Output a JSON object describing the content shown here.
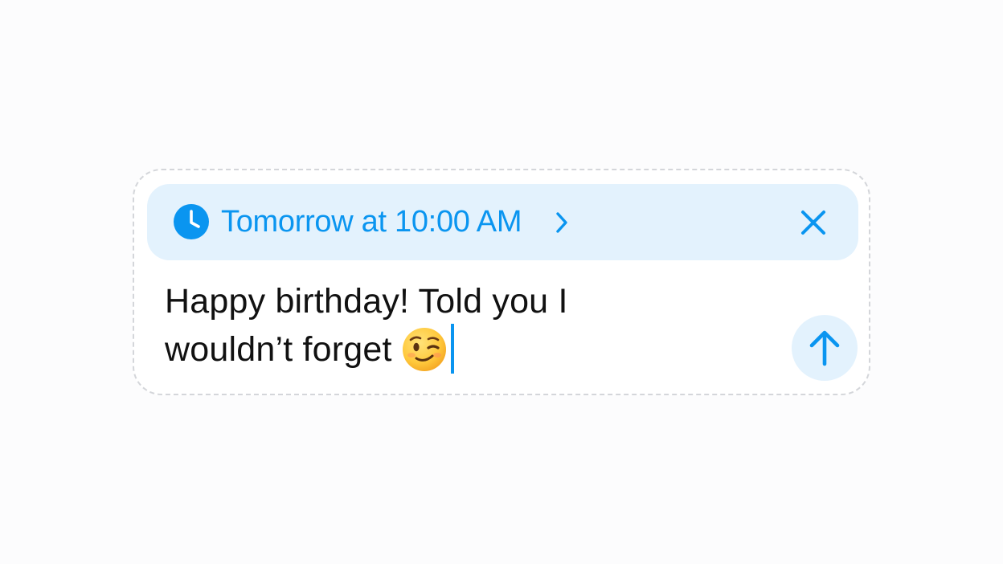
{
  "schedule": {
    "label": "Tomorrow at 10:00 AM",
    "icon": "clock-icon",
    "expand_icon": "chevron-right-icon",
    "dismiss_icon": "close-icon"
  },
  "message": {
    "line1": "Happy birthday! Told you I",
    "line2": "wouldn’t forget",
    "emoji": "winking-face-emoji"
  },
  "send": {
    "icon": "arrow-up-icon"
  },
  "colors": {
    "accent": "#0a95f0",
    "accent_bg": "#e3f2fd",
    "border": "#d4d6da",
    "text": "#111111",
    "background": "#fcfcfd"
  }
}
